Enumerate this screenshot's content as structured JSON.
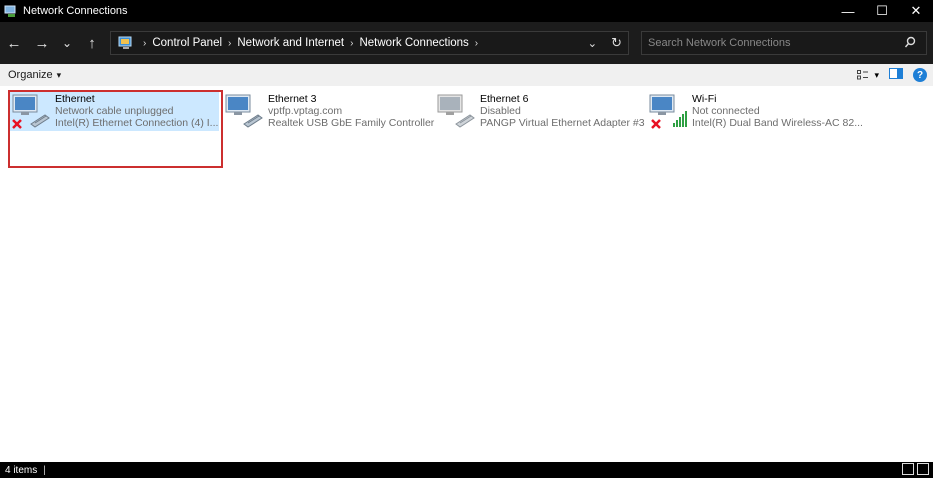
{
  "window": {
    "title": "Network Connections",
    "controls": {
      "minimize": "—",
      "maximize": "☐",
      "close": "✕"
    }
  },
  "nav": {
    "back": "←",
    "forward": "→",
    "recent": "⌄",
    "up": "↑",
    "breadcrumb": [
      "Control Panel",
      "Network and Internet",
      "Network Connections"
    ],
    "refresh": "↻",
    "dropdown": "⌄"
  },
  "search": {
    "placeholder": "Search Network Connections"
  },
  "command_bar": {
    "organize_label": "Organize",
    "organize_arrow": "▾",
    "view_arrow": "▾",
    "help": "?"
  },
  "connections": [
    {
      "name": "Ethernet",
      "status": "Network cable unplugged",
      "device": "Intel(R) Ethernet Connection (4) I...",
      "type": "wired",
      "error": true,
      "selected": true
    },
    {
      "name": "Ethernet 3",
      "status": "vptfp.vptag.com",
      "device": "Realtek USB GbE Family Controller",
      "type": "wired",
      "error": false,
      "selected": false
    },
    {
      "name": "Ethernet 6",
      "status": "Disabled",
      "device": "PANGP Virtual Ethernet Adapter #3",
      "type": "wired-disabled",
      "error": false,
      "selected": false
    },
    {
      "name": "Wi-Fi",
      "status": "Not connected",
      "device": "Intel(R) Dual Band Wireless-AC 82...",
      "type": "wireless",
      "error": true,
      "selected": false
    }
  ],
  "statusbar": {
    "count": "4 items",
    "pipe": "|"
  },
  "colors": {
    "dark_bg": "#1c1c1c",
    "selection": "#cce8ff",
    "highlight_border": "#cc2f2f",
    "help_blue": "#1e7fd6",
    "error_red": "#e81123",
    "signal_green": "#2ea043"
  }
}
